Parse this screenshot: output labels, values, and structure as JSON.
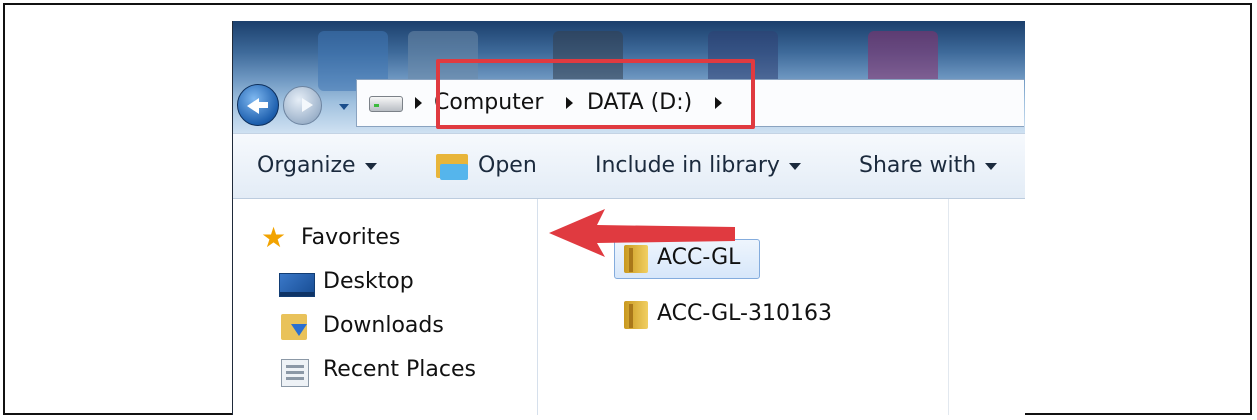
{
  "address_bar": {
    "crumbs": [
      "Computer",
      "DATA (D:)"
    ]
  },
  "toolbar": {
    "organize": "Organize",
    "open": "Open",
    "include_in_library": "Include in library",
    "share_with": "Share with"
  },
  "nav_pane": {
    "favorites": "Favorites",
    "items": [
      "Desktop",
      "Downloads",
      "Recent Places"
    ]
  },
  "files": [
    {
      "name": "ACC-GL",
      "selected": true
    },
    {
      "name": "ACC-GL-310163",
      "selected": false
    }
  ],
  "colors": {
    "highlight": "#e03a40",
    "arrow": "#e03a40"
  }
}
